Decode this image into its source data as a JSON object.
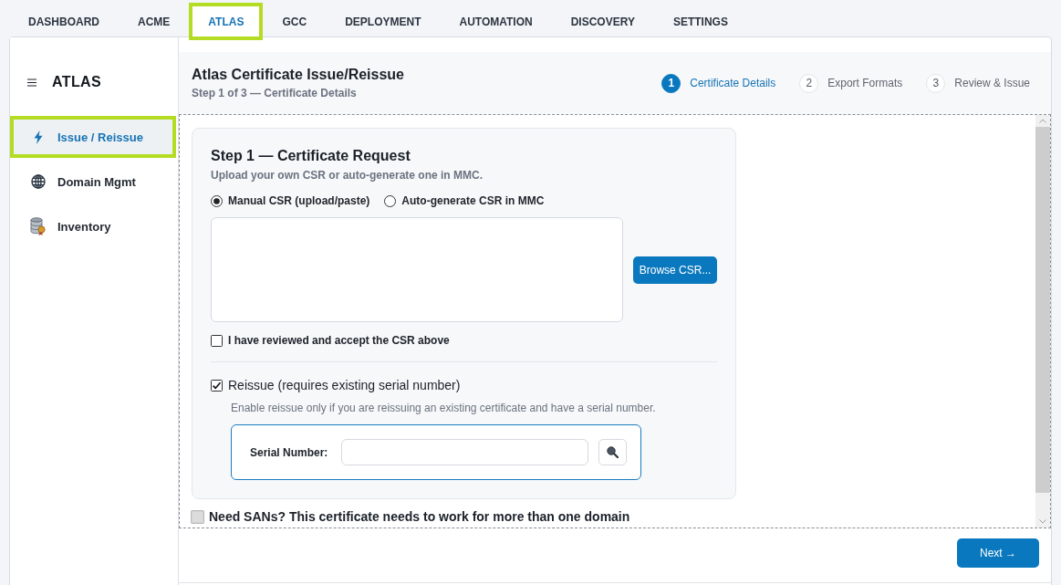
{
  "top_tabs": [
    {
      "label": "DASHBOARD",
      "selected": false
    },
    {
      "label": "ACME",
      "selected": false
    },
    {
      "label": "ATLAS",
      "selected": true
    },
    {
      "label": "GCC",
      "selected": false
    },
    {
      "label": "DEPLOYMENT",
      "selected": false
    },
    {
      "label": "AUTOMATION",
      "selected": false
    },
    {
      "label": "DISCOVERY",
      "selected": false
    },
    {
      "label": "SETTINGS",
      "selected": false
    }
  ],
  "sidebar": {
    "title": "ATLAS",
    "items": [
      {
        "label": "Issue / Reissue",
        "selected": true
      },
      {
        "label": "Domain Mgmt",
        "selected": false
      },
      {
        "label": "Inventory",
        "selected": false
      }
    ]
  },
  "header": {
    "title": "Atlas Certificate Issue/Reissue",
    "subtitle": "Step 1 of 3 — Certificate Details",
    "steps": [
      {
        "number": "1",
        "label": "Certificate Details",
        "selected": true
      },
      {
        "number": "2",
        "label": "Export Formats",
        "selected": false
      },
      {
        "number": "3",
        "label": "Review & Issue",
        "selected": false
      }
    ]
  },
  "request_card": {
    "title": "Step 1 — Certificate Request",
    "subtitle": "Upload your own CSR or auto-generate one in MMC.",
    "csr_modes": [
      {
        "label": "Manual CSR (upload/paste)",
        "selected": true
      },
      {
        "label": "Auto-generate CSR in MMC",
        "selected": false
      }
    ],
    "browse_button": "Browse CSR...",
    "accept": {
      "label": "I have reviewed and accept the CSR above",
      "checked": false
    },
    "reissue": {
      "label": "Reissue (requires existing serial number)",
      "checked": true,
      "help": "Enable reissue only if you are reissuing an existing certificate and have a serial number.",
      "serial_label": "Serial Number:"
    }
  },
  "sans": {
    "label": "Need SANs? This certificate needs to work for more than one domain",
    "checked": false
  },
  "footer": {
    "next_button": "Next →"
  }
}
